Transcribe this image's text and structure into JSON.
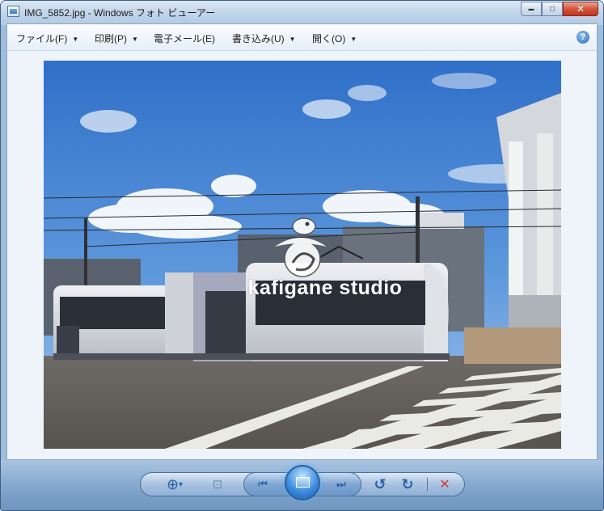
{
  "window": {
    "title": "IMG_5852.jpg - Windows フォト ビューアー",
    "minimize_glyph": "▬",
    "maximize_glyph": "□",
    "close_glyph": "✕"
  },
  "menubar": {
    "items": [
      {
        "label": "ファイル(F)",
        "has_dropdown": true
      },
      {
        "label": "印刷(P)",
        "has_dropdown": true
      },
      {
        "label": "電子メール(E)",
        "has_dropdown": false
      },
      {
        "label": "書き込み(U)",
        "has_dropdown": true
      },
      {
        "label": "開く(O)",
        "has_dropdown": true
      }
    ],
    "dropdown_glyph": "▼",
    "help_glyph": "?"
  },
  "photo": {
    "watermark_text": "kafigane studio"
  },
  "toolbar": {
    "icons": [
      "zoom-icon",
      "actual-size-icon",
      "previous-icon",
      "slideshow-icon",
      "next-icon",
      "rotate-left-icon",
      "rotate-right-icon",
      "delete-icon"
    ],
    "zoom_glyph": "⊕",
    "zoom_arrow": "▾",
    "actual_size_glyph": "⊡",
    "previous_glyph": "⏮",
    "next_glyph": "⏭",
    "rotate_left_glyph": "↺",
    "rotate_right_glyph": "↻",
    "delete_glyph": "✕"
  },
  "colors": {
    "accent": "#2a5ea8",
    "delete": "#d03a2a",
    "title_bar": "#c3d6ea"
  }
}
